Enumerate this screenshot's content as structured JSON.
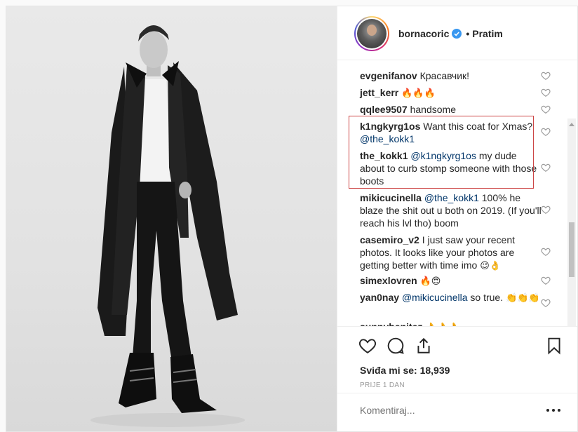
{
  "post": {
    "username": "bornacoric",
    "follow_label": "Pratim",
    "dot": "•"
  },
  "comments": [
    {
      "user": "evgenifanov",
      "text": "Красавчик!"
    },
    {
      "user": "jett_kerr",
      "text": "🔥🔥🔥"
    },
    {
      "user": "qqlee9507",
      "text": "handsome"
    },
    {
      "user": "k1ngkyrg1os",
      "text": "Want this coat for Xmas?",
      "mention": "@the_kokk1"
    },
    {
      "user": "the_kokk1",
      "mention": "@k1ngkyrg1os",
      "text": "my dude about to curb stomp someone with those boots"
    },
    {
      "user": "mikicucinella",
      "mention": "@the_kokk1",
      "text": "100% he blaze the shit out u both on 2019. (If you'll reach his lvl tho) boom"
    },
    {
      "user": "casemiro_v2",
      "text": "I just saw your recent photos. It looks like your photos are getting better with time imo",
      "emoji": "😉👌"
    },
    {
      "user": "simexlovren",
      "text": "🔥😍"
    },
    {
      "user": "yan0nay",
      "mention": "@mikicucinella",
      "text": "so true.",
      "emoji": "👏👏👏"
    },
    {
      "user": "sunnybenitez",
      "text": "👌👌👌"
    }
  ],
  "actions": {
    "likes_label": "Sviđa mi se:",
    "likes_count": "18,939",
    "time": "PRIJE 1 DAN",
    "comment_placeholder": "Komentiraj...",
    "icons": [
      "heart-outline-icon",
      "comment-icon",
      "share-icon",
      "bookmark-icon",
      "more-options-icon"
    ]
  },
  "colors": {
    "text": "#262626",
    "mention": "#003569",
    "muted": "#999999",
    "highlight_border": "#cc4444",
    "verified": "#3897f0"
  }
}
